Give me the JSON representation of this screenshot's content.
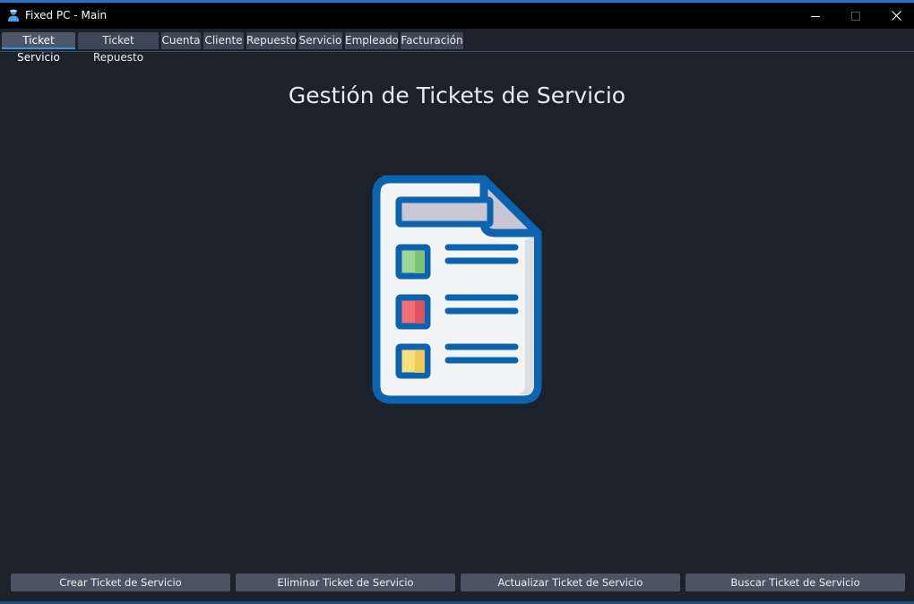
{
  "window": {
    "title": "Fixed PC - Main",
    "icon": "user-icon",
    "accent_color": "#1e78d2"
  },
  "tabs": [
    {
      "label": "Ticket Servicio",
      "active": true
    },
    {
      "label": "Ticket Repuesto",
      "active": false
    },
    {
      "label": "Cuenta",
      "active": false
    },
    {
      "label": "Cliente",
      "active": false
    },
    {
      "label": "Repuesto",
      "active": false
    },
    {
      "label": "Servicio",
      "active": false
    },
    {
      "label": "Empleado",
      "active": false
    },
    {
      "label": "Facturación",
      "active": false
    }
  ],
  "main": {
    "heading": "Gestión de Tickets de Servicio",
    "illustration": "document-checklist-icon"
  },
  "actions": {
    "create": "Crear Ticket de Servicio",
    "delete": "Eliminar Ticket de Servicio",
    "update": "Actualizar Ticket de Servicio",
    "search": "Buscar Ticket de Servicio"
  },
  "colors": {
    "background": "#1b222b",
    "button": "#4a5462",
    "tab": "#3d4654",
    "icon_outline": "#0c64b0",
    "checkbox_green": "#9ed693",
    "checkbox_red": "#f07075",
    "checkbox_yellow": "#f8e07a"
  }
}
